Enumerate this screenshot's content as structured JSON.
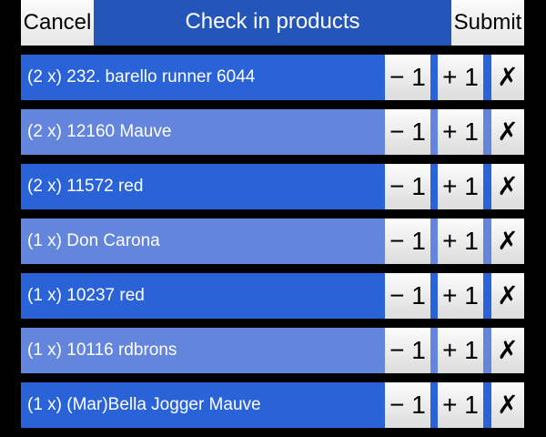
{
  "header": {
    "cancel_label": "Cancel",
    "title": "Check in products",
    "submit_label": "Submit"
  },
  "actions": {
    "decrement_label": "− 1",
    "increment_label": "+ 1",
    "remove_label": "✗"
  },
  "products": [
    {
      "label": "(2 x) 232. barello runner 6044"
    },
    {
      "label": "(2 x) 12160 Mauve"
    },
    {
      "label": "(2 x) 11572 red"
    },
    {
      "label": "(1 x) Don Carona"
    },
    {
      "label": "(1 x) 10237 red"
    },
    {
      "label": "(1 x) 10116 rdbrons"
    },
    {
      "label": "(1 x) (Mar)Bella Jogger Mauve"
    }
  ],
  "colors": {
    "background": "#000000",
    "title_bar": "#2356b8",
    "row_dark": "#2a63d8",
    "row_light": "#6385dc",
    "button": "#f0f0f0"
  }
}
